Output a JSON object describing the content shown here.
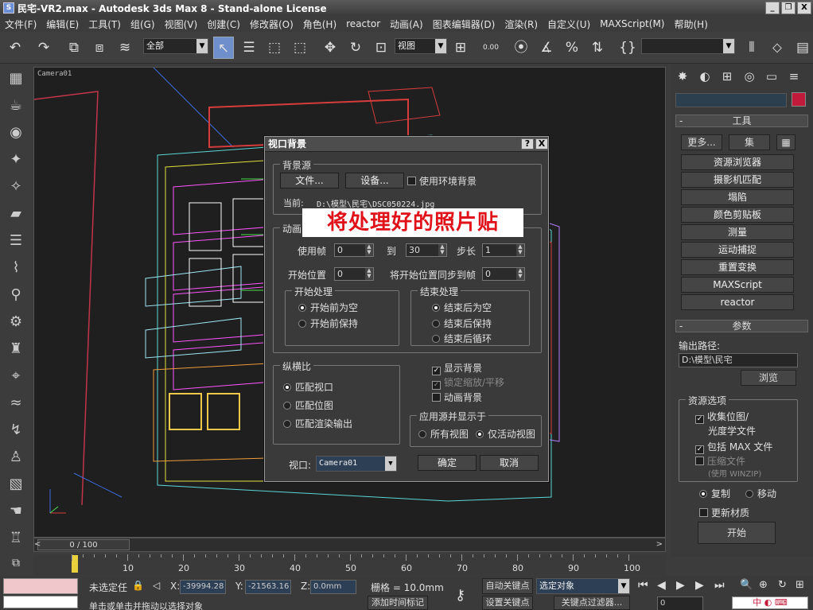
{
  "window": {
    "title": "民宅-VR2.max - Autodesk 3ds Max 8 - Stand-alone License",
    "app_icon": "3ds-max-icon",
    "controls": [
      "_",
      "ð",
      "X"
    ]
  },
  "menu": [
    "文件(F)",
    "编辑(E)",
    "工具(T)",
    "组(G)",
    "视图(V)",
    "创建(C)",
    "修改器(O)",
    "角色(H)",
    "reactor",
    "动画(A)",
    "图表编辑器(D)",
    "渲染(R)",
    "自定义(U)",
    "MAXScript(M)",
    "帮助(H)"
  ],
  "toolbar": {
    "selection_filter": "全部",
    "ref_coord": "视图",
    "angle_snap": "0.00"
  },
  "viewport": {
    "label": "Camera01",
    "frame_counter": "0 / 100"
  },
  "timeline": {
    "ticks": [
      "10",
      "20",
      "30",
      "40",
      "50",
      "60",
      "70",
      "80",
      "90",
      "100"
    ]
  },
  "overlay_caption": "将处理好的照片贴",
  "dialog": {
    "title": "视口背景",
    "help": "?",
    "close": "X",
    "bg_source": {
      "caption": "背景源",
      "files_btn": "文件...",
      "devices_btn": "设备...",
      "use_env_label": "使用环境背景",
      "current_label": "当前:",
      "current_path": "D:\\模型\\民宅\\DSC050224.jpg"
    },
    "anim": {
      "caption": "动画同步",
      "use_frame_label": "使用帧",
      "use_frame_val": "0",
      "to_label": "到",
      "to_val": "30",
      "step_label": "步长",
      "step_val": "1",
      "start_label": "开始位置",
      "start_val": "0",
      "sync_label": "将开始位置同步到帧",
      "sync_val": "0"
    },
    "start_proc": {
      "caption": "开始处理",
      "opt1": "开始前为空",
      "opt2": "开始前保持"
    },
    "end_proc": {
      "caption": "结束处理",
      "opt1": "结束后为空",
      "opt2": "结束后保持",
      "opt3": "结束后循环"
    },
    "aspect": {
      "caption": "纵横比",
      "opt1": "匹配视口",
      "opt2": "匹配位图",
      "opt3": "匹配渲染输出"
    },
    "display_bg": "显示背景",
    "lock_zoom": "锁定缩放/平移",
    "animate_bg": "动画背景",
    "apply": {
      "caption": "应用源并显示于",
      "opt1": "所有视图",
      "opt2": "仅活动视图"
    },
    "viewport_label": "视口:",
    "viewport_val": "Camera01",
    "ok": "确定",
    "cancel": "取消"
  },
  "right_panel": {
    "tools_header": "工具",
    "more_btn": "更多...",
    "sets_btn": "集",
    "utilities": [
      "资源浏览器",
      "摄影机匹配",
      "塌陷",
      "颜色剪贴板",
      "测量",
      "运动捕捉",
      "重置变换",
      "MAXScript",
      "reactor"
    ],
    "params_header": "参数",
    "output_path_label": "输出路径:",
    "output_path_val": "D:\\模型\\民宅",
    "browse_btn": "浏览",
    "res_options_caption": "资源选项",
    "collect_bitmaps": "收集位图/",
    "photometric": "光度学文件",
    "include_max": "包括 MAX 文件",
    "compress": "压缩文件",
    "use_winzip": "(使用 WINZIP)",
    "copy": "复制",
    "move": "移动",
    "update_materials": "更新材质",
    "start_btn": "开始",
    "swatch_color": "#c21a3a"
  },
  "status": {
    "selection": "未选定任",
    "x_val": "-39994.28",
    "y_val": "-21563.16",
    "z_val": "0.0mm",
    "grid": "栅格 = 10.0mm",
    "auto_key": "自动关键点",
    "selected_obj": "选定对象",
    "set_key": "设置关键点",
    "key_filters": "关键点过滤器...",
    "add_time_tag": "添加时间标记",
    "prompt": "单击或单击并拖动以选择对象",
    "frame_val": "0"
  }
}
